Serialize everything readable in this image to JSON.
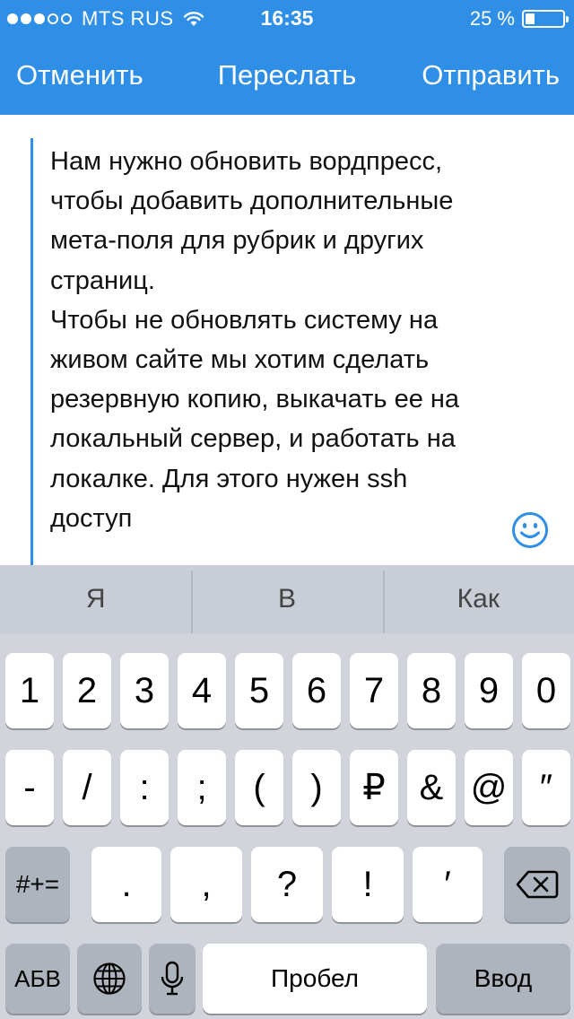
{
  "status_bar": {
    "carrier": "MTS RUS",
    "time": "16:35",
    "battery_percent": "25 %",
    "battery_level": 0.25
  },
  "nav": {
    "cancel": "Отменить",
    "forward": "Переслать",
    "send": "Отправить"
  },
  "compose": {
    "message": "Нам нужно обновить вордпресс,\nчтобы добавить дополнительные\nмета-поля для рубрик и других\nстраниц.\nЧтобы не обновлять систему на\nживом сайте мы хотим сделать\nрезервную копию, выкачать ее на\nлокальный сервер, и работать на\nлокалке. Для этого нужен ssh\nдоступ",
    "emoji_icon": "smiley-icon"
  },
  "predictions": [
    "Я",
    "В",
    "Как"
  ],
  "keyboard": {
    "row1": [
      "1",
      "2",
      "3",
      "4",
      "5",
      "6",
      "7",
      "8",
      "9",
      "0"
    ],
    "row2": [
      "-",
      "/",
      ":",
      ";",
      "(",
      ")",
      "₽",
      "&",
      "@",
      "″"
    ],
    "row3_mode": "#+=",
    "row3": [
      ".",
      ",",
      "?",
      "!",
      "′"
    ],
    "backspace_icon": "backspace-icon",
    "abc": "АБВ",
    "globe_icon": "globe-icon",
    "mic_icon": "microphone-icon",
    "space": "Пробел",
    "return": "Ввод"
  }
}
